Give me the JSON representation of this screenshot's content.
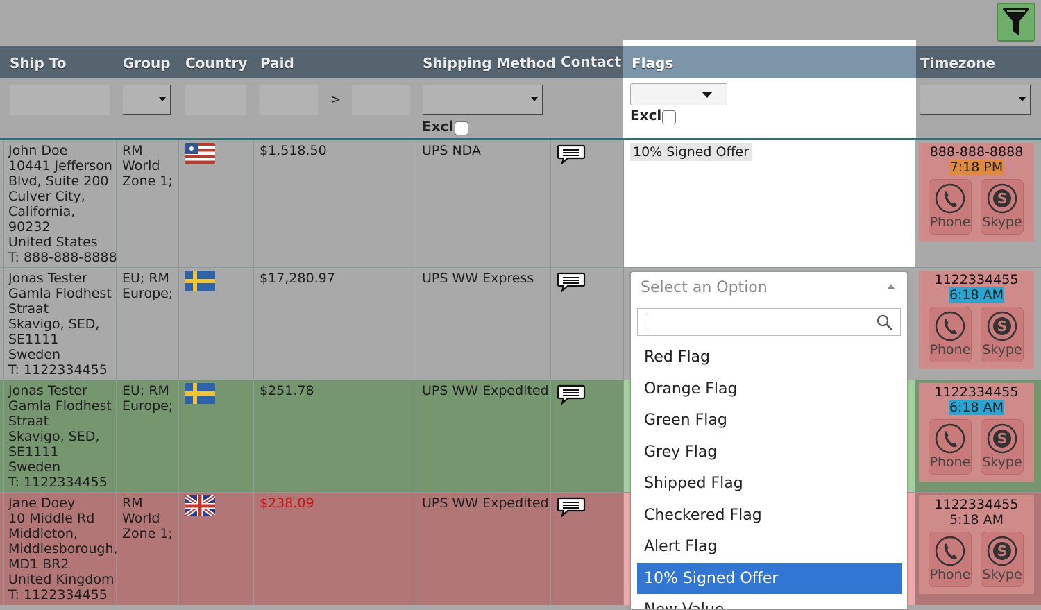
{
  "toolbar": {
    "filter_icon": "funnel-icon"
  },
  "columns": {
    "ship_to": "Ship To",
    "group": "Group",
    "country": "Country",
    "paid": "Paid",
    "shipping_method": "Shipping Method",
    "contact": "Contact",
    "flags": "Flags",
    "timezone": "Timezone"
  },
  "filters": {
    "paid_sep": ">",
    "shipping_excl": "Excl",
    "flags_excl": "Excl"
  },
  "rows": [
    {
      "ship_to": [
        "John Doe",
        "10441 Jefferson",
        "Blvd, Suite 200",
        "Culver City,",
        "California,",
        "90232",
        "United States",
        "T: 888-888-8888"
      ],
      "group": [
        "RM",
        "World",
        "Zone 1;"
      ],
      "country_flag": "us-flag",
      "paid": "$1,518.50",
      "shipping_method": "UPS NDA",
      "flag": "10% Signed Offer",
      "tz_phone": "888-888-8888",
      "tz_time": "7:18 PM",
      "tz_time_color": "#e08a3a",
      "phone_label": "Phone",
      "skype_label": "Skype",
      "row_color": "#a9a9a9"
    },
    {
      "ship_to": [
        "Jonas Tester",
        "Gamla Flodhest",
        "Straat",
        "Skavigo, SED,",
        "SE1111",
        "Sweden",
        "T: 1122334455"
      ],
      "group": [
        "EU; RM",
        "Europe;"
      ],
      "country_flag": "se-flag",
      "paid": "$17,280.97",
      "shipping_method": "UPS WW Express",
      "flag": "",
      "tz_phone": "1122334455",
      "tz_time": "6:18 AM",
      "tz_time_color": "#27a6d6",
      "phone_label": "Phone",
      "skype_label": "Skype",
      "row_color": "#a9a9a9"
    },
    {
      "ship_to": [
        "Jonas Tester",
        "Gamla Flodhest",
        "Straat",
        "Skavigo, SED,",
        "SE1111",
        "Sweden",
        "T: 1122334455"
      ],
      "group": [
        "EU; RM",
        "Europe;"
      ],
      "country_flag": "se-flag",
      "paid": "$251.78",
      "shipping_method": "UPS WW Expedited",
      "flag": "",
      "tz_phone": "1122334455",
      "tz_time": "6:18 AM",
      "tz_time_color": "#27a6d6",
      "phone_label": "Phone",
      "skype_label": "Skype",
      "row_color": "#76966f"
    },
    {
      "ship_to": [
        "Jane Doey",
        "10 Middle Rd",
        "Middleton,",
        "Middlesborough,",
        "MD1 BR2",
        "United Kingdom",
        "T: 1122334455"
      ],
      "group": [
        "RM",
        "World",
        "Zone 1;"
      ],
      "country_flag": "uk-flag",
      "paid": "$238.09",
      "paid_color": "#cc1111",
      "shipping_method": "UPS WW Expedited",
      "flag": "",
      "tz_phone": "1122334455",
      "tz_time": "5:18 AM",
      "tz_time_color": "",
      "phone_label": "Phone",
      "skype_label": "Skype",
      "row_color": "#b27676"
    }
  ],
  "dropdown": {
    "placeholder": "Select an Option",
    "search_value": "",
    "options": [
      "Red Flag",
      "Orange Flag",
      "Green Flag",
      "Grey Flag",
      "Shipped Flag",
      "Checkered Flag",
      "Alert Flag",
      "10% Signed Offer",
      "New Value"
    ],
    "selected": "10% Signed Offer"
  }
}
